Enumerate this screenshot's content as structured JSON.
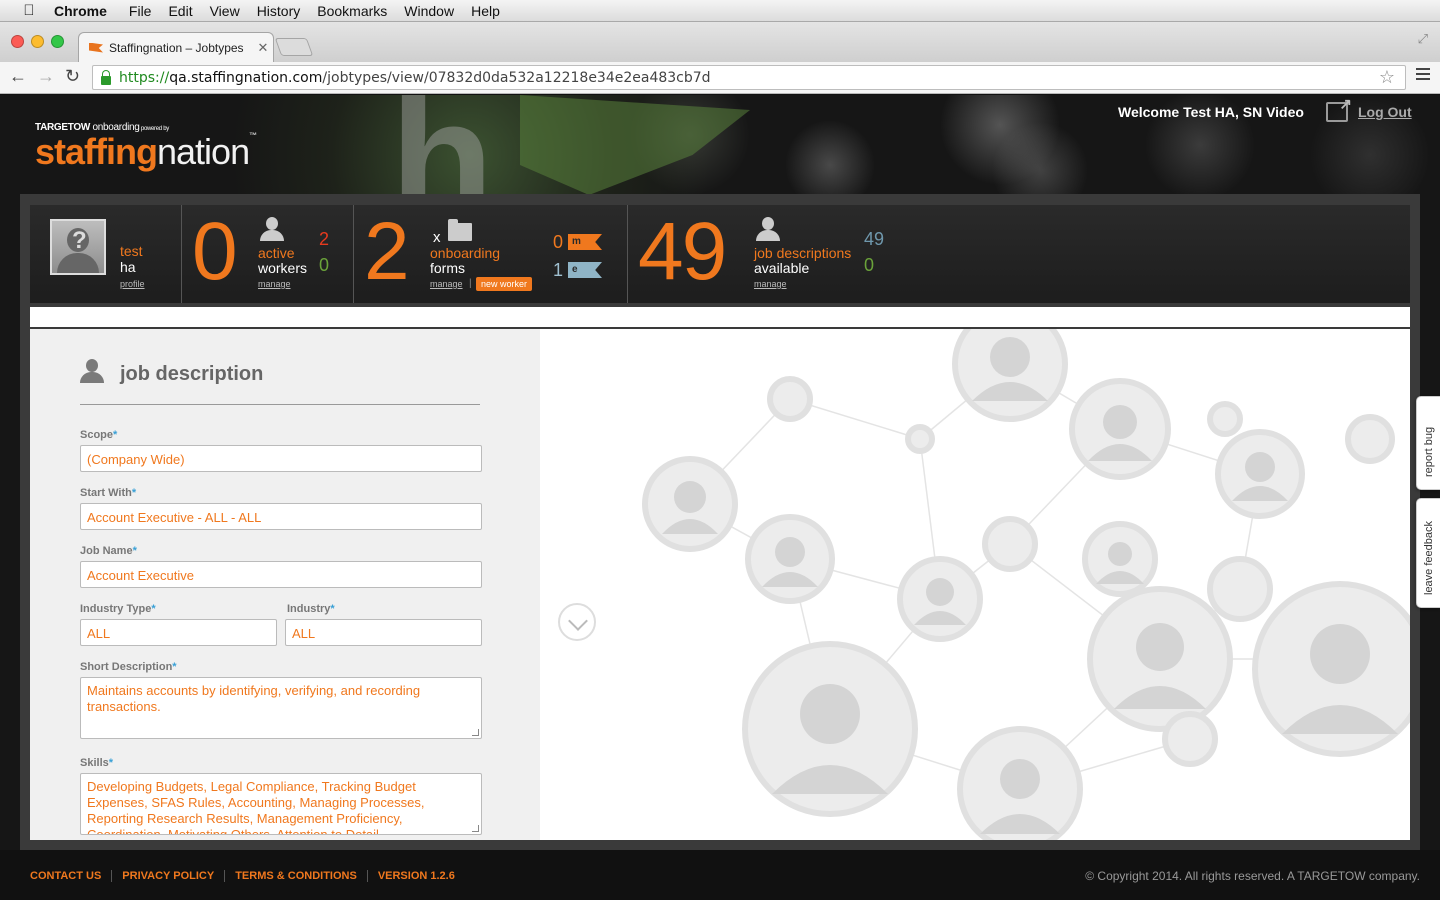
{
  "menubar": {
    "app": "Chrome",
    "items": [
      "File",
      "Edit",
      "View",
      "History",
      "Bookmarks",
      "Window",
      "Help"
    ]
  },
  "browser": {
    "tab_title": "Staffingnation – Jobtypes",
    "url_scheme": "https://",
    "url_host": "qa.staffingnation.com",
    "url_path": "/jobtypes/view/07832d0da532a12218e34e2ea483cb7d"
  },
  "brand": {
    "powered_by_target": "TARGET",
    "powered_by_ow": "OW",
    "powered_by_onboarding": " onboarding",
    "powered_by_small": " powered by",
    "word1": "staffing",
    "word2": "nation",
    "tm": "™"
  },
  "header": {
    "welcome": "Welcome Test HA, SN Video",
    "logout": "Log Out",
    "hero_letter": "h"
  },
  "stats": {
    "profile": {
      "first": "test",
      "last": "ha",
      "link": "profile",
      "avatar_glyph": "?"
    },
    "active": {
      "count": "0",
      "label1": "active",
      "label2": "workers",
      "red": "2",
      "green": "0",
      "link": "manage"
    },
    "onboarding": {
      "count": "2",
      "x": "x",
      "label1": "onboarding",
      "label2": "forms",
      "link": "manage",
      "sep": "|",
      "new_worker": "new worker",
      "flag1_count": "0",
      "flag1_letter": "m",
      "flag2_count": "1",
      "flag2_letter": "e"
    },
    "jobs": {
      "count": "49",
      "label1": "job descriptions",
      "label2": "available",
      "link": "manage",
      "top": "49",
      "bottom": "0"
    }
  },
  "form": {
    "title": "job description",
    "required_mark": "*",
    "scope_label": "Scope",
    "scope_value": "(Company Wide)",
    "start_label": "Start With",
    "start_value": "Account Executive - ALL - ALL",
    "jobname_label": "Job Name",
    "jobname_value": "Account Executive",
    "industry_type_label": "Industry Type",
    "industry_type_value": "ALL",
    "industry_label": "Industry",
    "industry_value": "ALL",
    "short_desc_label": "Short Description",
    "short_desc_value": "Maintains accounts by identifying, verifying, and recording transactions.",
    "skills_label": "Skills",
    "skills_value": "Developing Budgets, Legal Compliance, Tracking Budget Expenses, SFAS Rules, Accounting, Managing Processes, Reporting Research Results, Management Proficiency, Coordination, Motivating Others, Attention to Detail"
  },
  "side_tabs": {
    "report_bug": "report bug",
    "feedback": "leave feedback"
  },
  "footer": {
    "links": [
      "CONTACT US",
      "PRIVACY POLICY",
      "TERMS & CONDITIONS",
      "VERSION 1.2.6"
    ],
    "copyright": "© Copyright 2014. All rights reserved. A TARGETOW company."
  },
  "colors": {
    "accent": "#f0781e",
    "red": "#e63a1e",
    "green": "#6aa23a",
    "blue": "#6f98ad"
  }
}
